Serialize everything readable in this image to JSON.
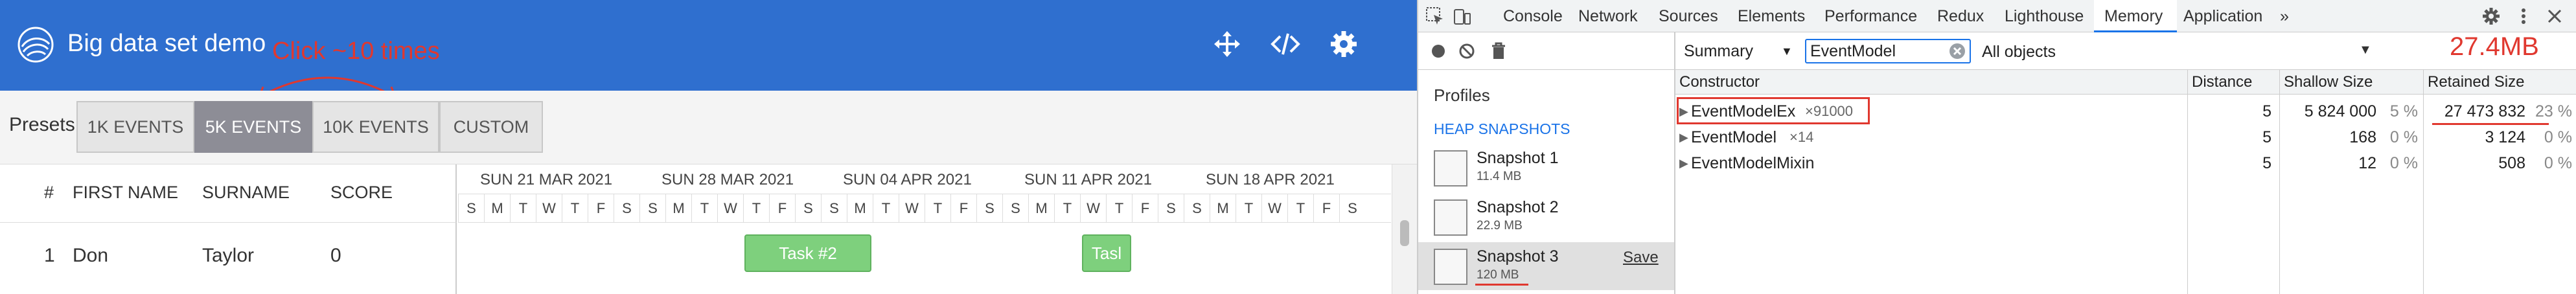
{
  "app": {
    "title": "Big data set demo",
    "annotation": "Click ~10 times",
    "presets_label": "Presets",
    "presets": [
      {
        "label": "1K EVENTS",
        "active": false
      },
      {
        "label": "5K EVENTS",
        "active": true
      },
      {
        "label": "10K EVENTS",
        "active": false
      },
      {
        "label": "CUSTOM",
        "active": false
      }
    ],
    "columns": [
      "#",
      "FIRST NAME",
      "SURNAME",
      "SCORE"
    ],
    "rows": [
      {
        "index": "1",
        "first_name": "Don",
        "surname": "Taylor",
        "score": "0"
      }
    ],
    "weeks": [
      "SUN 21 MAR 2021",
      "SUN 28 MAR 2021",
      "SUN 04 APR 2021",
      "SUN 11 APR 2021",
      "SUN 18 APR 2021"
    ],
    "days": [
      "S",
      "M",
      "T",
      "W",
      "T",
      "F",
      "S"
    ],
    "tasks": [
      "Task #2",
      "Tasl"
    ],
    "header_icons": [
      "move-icon",
      "code-icon",
      "settings-icon"
    ]
  },
  "devtools": {
    "tabs": [
      "Console",
      "Network",
      "Sources",
      "Elements",
      "Performance",
      "Redux",
      "Lighthouse",
      "Memory",
      "Application",
      "»"
    ],
    "active_tab": "Memory",
    "view": "Summary",
    "class_filter": "EventModel",
    "object_filter": "All objects",
    "memory_annotation": "27.4MB",
    "profiles_title": "Profiles",
    "heap_snapshots_title": "HEAP SNAPSHOTS",
    "snapshots": [
      {
        "name": "Snapshot 1",
        "size": "11.4 MB",
        "active": false
      },
      {
        "name": "Snapshot 2",
        "size": "22.9 MB",
        "active": false
      },
      {
        "name": "Snapshot 3",
        "size": "120 MB",
        "active": true
      }
    ],
    "save_label": "Save",
    "table_headers": [
      "Constructor",
      "Distance",
      "Shallow Size",
      "Retained Size"
    ],
    "table_rows": [
      {
        "constructor": "EventModelEx",
        "count": "×91000",
        "distance": "5",
        "shallow": "5 824 000",
        "shallow_pct": "5 %",
        "retained": "27 473 832",
        "retained_pct": "23 %"
      },
      {
        "constructor": "EventModel",
        "count": "×14",
        "distance": "5",
        "shallow": "168",
        "shallow_pct": "0 %",
        "retained": "3 124",
        "retained_pct": "0 %"
      },
      {
        "constructor": "EventModelMixin",
        "count": "",
        "distance": "5",
        "shallow": "12",
        "shallow_pct": "0 %",
        "retained": "508",
        "retained_pct": "0 %"
      }
    ]
  },
  "colors": {
    "header_blue": "#2f6fcf",
    "annotation_red": "#e0382f",
    "task_green": "#7ed07d",
    "active_preset": "#8d8d96"
  }
}
